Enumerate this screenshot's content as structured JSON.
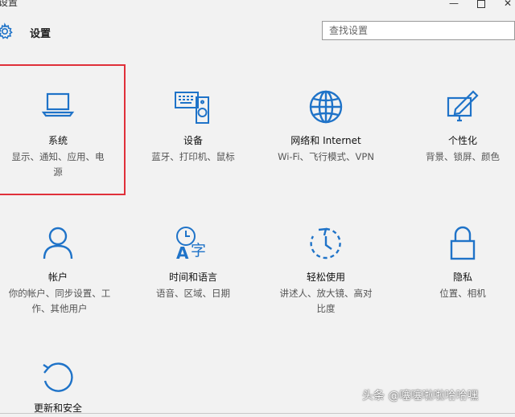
{
  "window": {
    "title": "设置",
    "minimize": "—",
    "close": "✕"
  },
  "header": {
    "title": "设置"
  },
  "search": {
    "placeholder": "查找设置"
  },
  "tiles": [
    {
      "label": "系统",
      "desc": "显示、通知、应用、电源",
      "icon": "laptop-icon"
    },
    {
      "label": "设备",
      "desc": "蓝牙、打印机、鼠标",
      "icon": "devices-icon"
    },
    {
      "label": "网络和 Internet",
      "desc": "Wi-Fi、飞行模式、VPN",
      "icon": "globe-icon"
    },
    {
      "label": "个性化",
      "desc": "背景、锁屏、颜色",
      "icon": "personalization-icon"
    },
    {
      "label": "帐户",
      "desc": "你的帐户、同步设置、工作、其他用户",
      "icon": "person-icon"
    },
    {
      "label": "时间和语言",
      "desc": "语音、区域、日期",
      "icon": "time-language-icon"
    },
    {
      "label": "轻松使用",
      "desc": "讲述人、放大镜、高对比度",
      "icon": "ease-of-access-icon"
    },
    {
      "label": "隐私",
      "desc": "位置、相机",
      "icon": "lock-icon"
    },
    {
      "label": "更新和安全",
      "desc": "",
      "icon": "update-icon"
    }
  ],
  "watermark": "头条 @噻噻啦啦哈哈嘿",
  "colors": {
    "accent": "#1f73c8",
    "highlight": "#e0303a",
    "background": "#f2f2f2"
  }
}
